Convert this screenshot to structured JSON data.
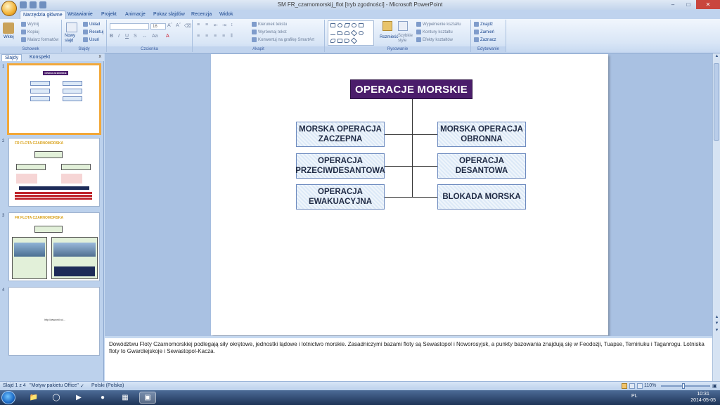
{
  "window": {
    "title": "SM FR_czarnomorskij_flot [tryb zgodności] - Microsoft PowerPoint"
  },
  "ribbon_tabs": [
    "Narzędzia główne",
    "Wstawianie",
    "Projekt",
    "Animacje",
    "Pokaz slajdów",
    "Recenzja",
    "Widok"
  ],
  "ribbon": {
    "clipboard": {
      "paste": "Wklej",
      "cut": "Wytnij",
      "copy": "Kopiuj",
      "format_painter": "Malarz formatów",
      "label": "Schowek"
    },
    "slides": {
      "new_slide": "Nowy slajd",
      "layout": "Układ",
      "reset": "Resetuj",
      "delete": "Usuń",
      "label": "Slajdy"
    },
    "font": {
      "size": "16",
      "label": "Czcionka"
    },
    "paragraph": {
      "text_direction": "Kierunek tekstu",
      "align_text": "Wyrównaj tekst",
      "smartart": "Konwertuj na grafikę SmartArt",
      "label": "Akapit"
    },
    "drawing": {
      "arrange": "Rozmieść",
      "quick_styles": "Szybkie style",
      "fill": "Wypełnienie kształtu",
      "outline": "Kontury kształtu",
      "effects": "Efekty kształtów",
      "label": "Rysowanie"
    },
    "editing": {
      "find": "Znajdź",
      "replace": "Zamień",
      "select": "Zaznacz",
      "label": "Edytowanie"
    }
  },
  "panel": {
    "tab_slides": "Slajdy",
    "tab_outline": "Konspekt",
    "close": "x"
  },
  "thumbnails": [
    {
      "num": "1",
      "title": "OPERACJE MORSKIE"
    },
    {
      "num": "2",
      "title": "FR FLOTA CZARNOMORSKA"
    },
    {
      "num": "3",
      "title": "FR FLOTA CZARNOMORSKA"
    },
    {
      "num": "4",
      "title": "http://www.mil.ru/..."
    }
  ],
  "slide": {
    "title": "OPERACJE MORSKIE",
    "left_boxes": [
      "MORSKA OPERACJA ZACZEPNA",
      "OPERACJA PRZECIWDESANTOWA",
      "OPERACJA EWAKUACYJNA"
    ],
    "right_boxes": [
      "MORSKA OPERACJA OBRONNA",
      "OPERACJA DESANTOWA",
      "BLOKADA MORSKA"
    ]
  },
  "notes": "Dowództwu Floty Czarnomorskiej podlegają siły okrętowe, jednostki lądowe i lotnictwo morskie. Zasadniczymi bazami floty są Sewastopol i Noworosyjsk, a punkty bazowania znajdują się w Feodozji, Tuapse, Temiriuku i Taganrogu. Lotniska floty to Gwardiejskoje i Sewastopol-Kacza.",
  "status": {
    "slide": "Slajd 1 z 4",
    "theme": "\"Motyw pakietu Office\"",
    "language": "Polski (Polska)",
    "zoom": "110%"
  },
  "taskbar": {
    "lang": "PL",
    "time": "10:31",
    "date": "2014-05-05"
  },
  "colors": {
    "title_box": "#4b1d6b",
    "box_fill": "#dce9f7",
    "box_border": "#6e8bbf",
    "accent": "#f2a83a"
  }
}
